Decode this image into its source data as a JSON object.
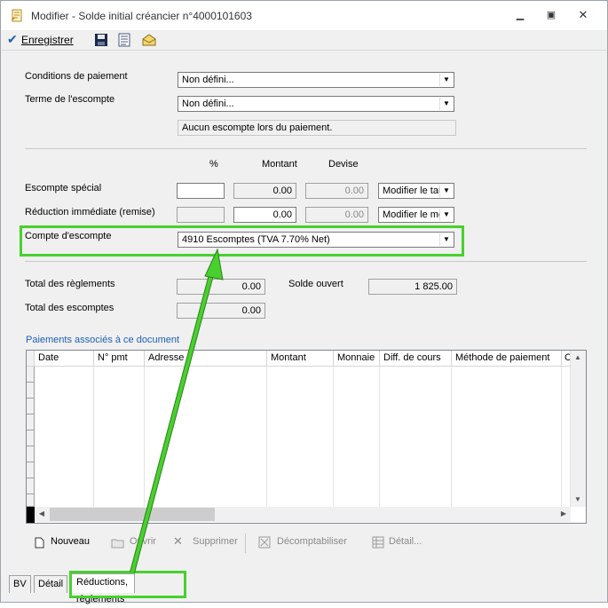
{
  "window": {
    "title": "Modifier - Solde initial créancier n°4000101603"
  },
  "toolbar": {
    "save_label": "Enregistrer"
  },
  "form": {
    "conditions_label": "Conditions de paiement",
    "conditions_value": "Non défini...",
    "terme_label": "Terme de l'escompte",
    "terme_value": "Non défini...",
    "escompte_info": "Aucun escompte lors du paiement.",
    "col_pct": "%",
    "col_montant": "Montant",
    "col_devise": "Devise",
    "escompte_special_label": "Escompte spécial",
    "escompte_special_montant": "0.00",
    "escompte_special_devise": "0.00",
    "escompte_special_mode": "Modifier le tau",
    "reduction_label": "Réduction immédiate (remise)",
    "reduction_montant": "0.00",
    "reduction_devise": "0.00",
    "reduction_mode": "Modifier le mo",
    "compte_label": "Compte d'escompte",
    "compte_value": "4910 Escomptes (TVA 7.70% Net)",
    "total_reglements_label": "Total des règlements",
    "total_reglements_value": "0.00",
    "solde_label": "Solde ouvert",
    "solde_value": "1 825.00",
    "total_escomptes_label": "Total des escomptes",
    "total_escomptes_value": "0.00"
  },
  "payments": {
    "section_title": "Paiements associés à ce document",
    "columns": [
      "Date",
      "N° pmt",
      "Adresse",
      "Montant",
      "Monnaie",
      "Diff. de cours",
      "Méthode de paiement",
      "C"
    ]
  },
  "actions": {
    "nouveau": "Nouveau",
    "ouvrir": "Ouvrir",
    "supprimer": "Supprimer",
    "decompta": "Décomptabiliser",
    "detail": "Détail..."
  },
  "tabs": [
    "BV",
    "Détail",
    "Réductions, règlements"
  ],
  "colors": {
    "highlight": "#48d12e",
    "link_blue": "#1f5fb4",
    "window_bg": "#f0f0f0"
  }
}
